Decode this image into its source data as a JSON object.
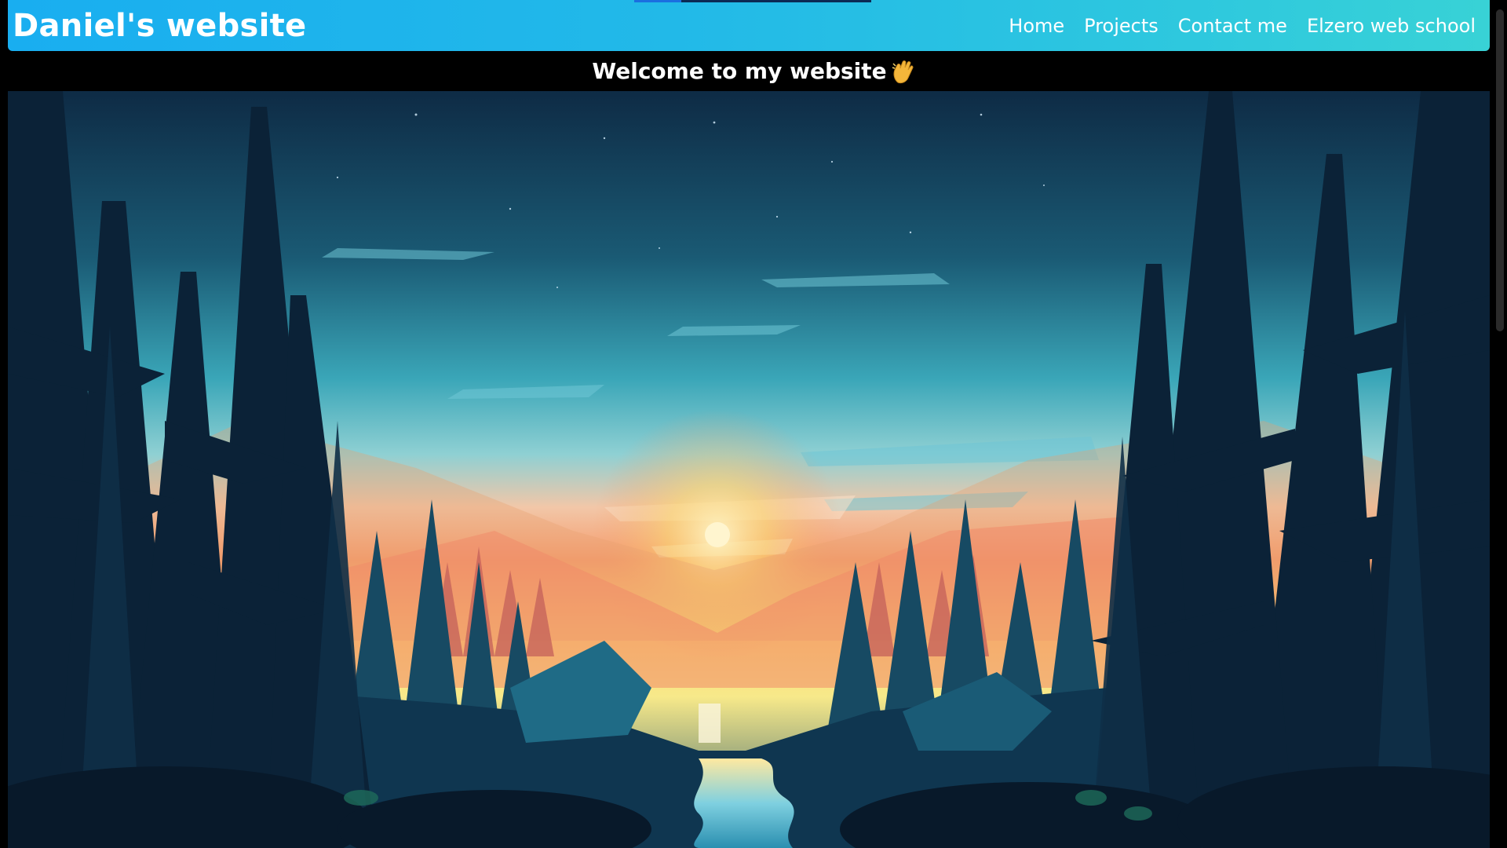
{
  "header": {
    "brand": "Daniel's website",
    "nav": [
      {
        "label": "Home"
      },
      {
        "label": "Projects"
      },
      {
        "label": "Contact me"
      },
      {
        "label": "Elzero web school"
      }
    ]
  },
  "banner": {
    "text": "Welcome to my website",
    "emoji_icon": "waving-hand-icon"
  },
  "hero": {
    "image": "forest-sunset-illustration"
  },
  "colors": {
    "header_gradient_start": "#19aef0",
    "header_gradient_end": "#38d2d6",
    "background": "#000000",
    "text": "#ffffff"
  }
}
